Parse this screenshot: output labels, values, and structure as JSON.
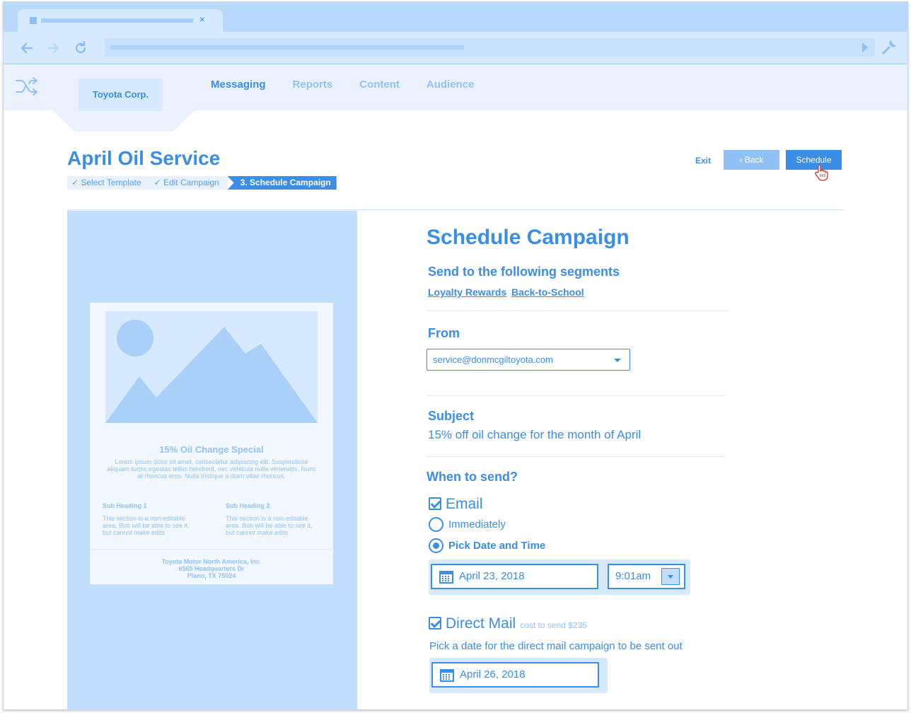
{
  "browser": {
    "tab_close": "×",
    "back_icon": "arrow-left-icon",
    "forward_icon": "arrow-right-icon",
    "reload_icon": "reload-icon",
    "tools_icon": "wrench-icon"
  },
  "header": {
    "org_name": "Toyota Corp.",
    "nav": [
      "Messaging",
      "Reports",
      "Content",
      "Audience"
    ],
    "active_nav": "Messaging"
  },
  "page": {
    "title": "April Oil Service",
    "steps": [
      "Select Template",
      "Edit Campaign",
      "3. Schedule Campaign"
    ],
    "exit_label": "Exit",
    "back_label": "‹  Back",
    "schedule_label": "Schedule"
  },
  "preview": {
    "title": "15% Oil Change Special",
    "body": "Lorem ipsum dolor sit amet, consectetur adipiscing elit. Suspendisse aliquam turpis egestas tellus hendrerit, nec vehicula nulla venenatis. Nunc at rhoncus eros. Nulla tristique a diam vitae rhoncus.",
    "sub1_heading": "Sub Heading 1",
    "sub1_text": "This section is a non-editable area. Bob will be able to see it, but cannot make edits",
    "sub2_heading": "Sub Heading 2",
    "sub2_text": "This section is a non-editable area. Bob will be able to see it, but cannot make edits",
    "footer_line1": "Toyota Motor North America, Inc.",
    "footer_line2": "6565 Headquarters Dr",
    "footer_line3": "Plano, TX 75024"
  },
  "form": {
    "heading": "Schedule Campaign",
    "segments_label": "Send to the following segments",
    "segments": [
      "Loyalty Rewards",
      "Back-to-School"
    ],
    "from_label": "From",
    "from_value": "service@donmcgiltoyota.com",
    "subject_label": "Subject",
    "subject_value": "15% off oil change for the month of April",
    "when_label": "When to send?",
    "email_label": "Email",
    "email_checked": true,
    "immediately_label": "Immediately",
    "pick_label": "Pick Date and Time",
    "selected_option": "Pick Date and Time",
    "email_date": "April 23, 2018",
    "email_time": "9:01am",
    "direct_mail_label": "Direct Mail",
    "direct_mail_checked": true,
    "direct_mail_cost": "cost to send $235",
    "direct_mail_hint": "Pick a date for the direct mail campaign to be sent out",
    "direct_mail_date": "April 26, 2018"
  },
  "colors": {
    "accent": "#3a8ee6",
    "light": "#90c2f6",
    "panel": "#c1deff",
    "chrome": "#b9d9fb"
  }
}
